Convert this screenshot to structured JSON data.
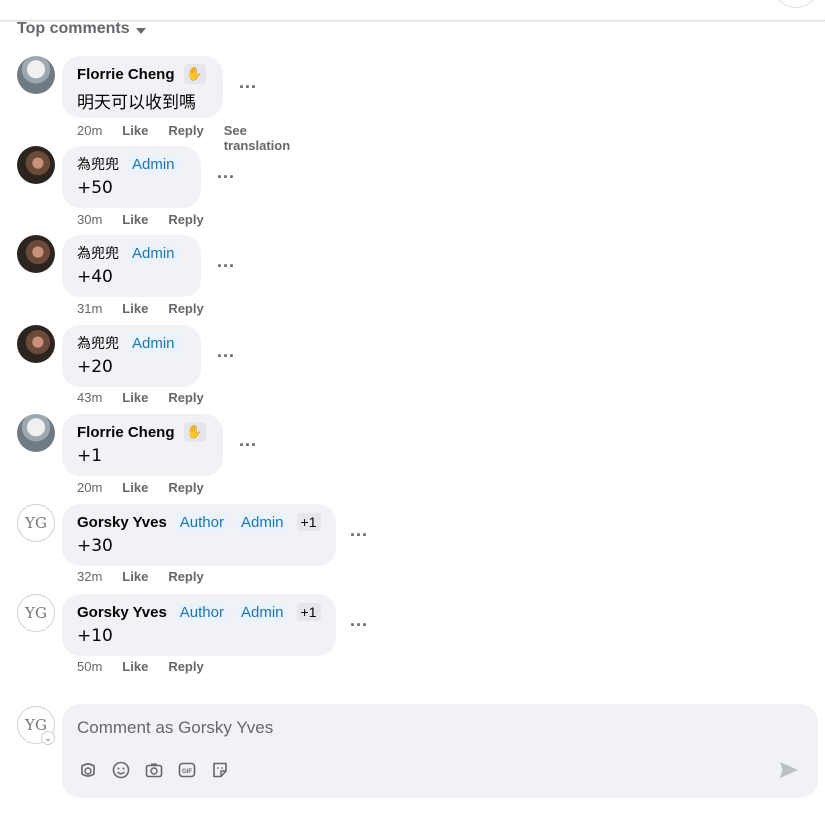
{
  "header": {
    "sort_label": "Top comments"
  },
  "comments": [
    {
      "author": "Florrie Cheng",
      "text": "明天可以收到嗎",
      "time": "20m",
      "like": "Like",
      "reply": "Reply",
      "extra": "See translation"
    },
    {
      "author": "為兜兜",
      "badge1": "Admin",
      "text": "+50",
      "time": "30m",
      "like": "Like",
      "reply": "Reply"
    },
    {
      "author": "為兜兜",
      "badge1": "Admin",
      "text": "+40",
      "time": "31m",
      "like": "Like",
      "reply": "Reply"
    },
    {
      "author": "為兜兜",
      "badge1": "Admin",
      "text": "+20",
      "time": "43m",
      "like": "Like",
      "reply": "Reply"
    },
    {
      "author": "Florrie Cheng",
      "text": "+1",
      "time": "20m",
      "like": "Like",
      "reply": "Reply"
    },
    {
      "author": "Gorsky Yves",
      "badge1": "Author",
      "badge2": "Admin",
      "badge3": "+1",
      "text": "+30",
      "time": "32m",
      "like": "Like",
      "reply": "Reply"
    },
    {
      "author": "Gorsky Yves",
      "badge1": "Author",
      "badge2": "Admin",
      "badge3": "+1",
      "text": "+10",
      "time": "50m",
      "like": "Like",
      "reply": "Reply"
    }
  ],
  "composer": {
    "placeholder": "Comment as Gorsky Yves",
    "icons": [
      "avatar-sticker-icon",
      "emoji-icon",
      "camera-icon",
      "gif-icon",
      "sticker-icon"
    ],
    "send_icon": "send-icon"
  },
  "more_label": "...",
  "logo_text": "YG"
}
